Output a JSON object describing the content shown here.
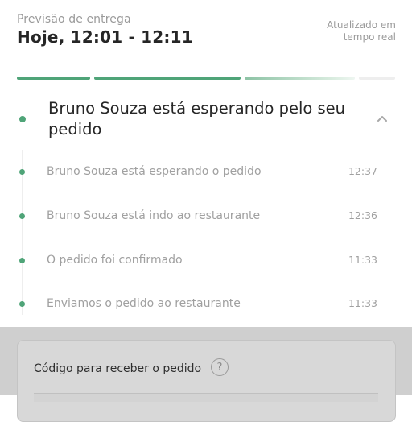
{
  "header": {
    "eta_label": "Previsão de entrega",
    "eta_time": "Hoje, 12:01 - 12:11",
    "updated_line1": "Atualizado em",
    "updated_line2": "tempo real"
  },
  "progress": {
    "segments": [
      "complete",
      "complete",
      "in-progress",
      "pending"
    ]
  },
  "status": {
    "title": "Bruno Souza está esperando pelo seu pedido",
    "expanded": true,
    "chevron_icon": "chevron-up-icon"
  },
  "timeline": {
    "items": [
      {
        "text": "Bruno Souza está esperando o pedido",
        "time": "12:37"
      },
      {
        "text": "Bruno Souza está indo ao restaurante",
        "time": "12:36"
      },
      {
        "text": "O pedido foi confirmado",
        "time": "11:33"
      },
      {
        "text": "Enviamos o pedido ao restaurante",
        "time": "11:33"
      }
    ]
  },
  "code_card": {
    "label": "Código para receber o pedido",
    "help_icon": "?"
  },
  "colors": {
    "accent": "#4fa478",
    "text_muted": "#a0a0a0",
    "overlay": "#cfcfcf"
  }
}
